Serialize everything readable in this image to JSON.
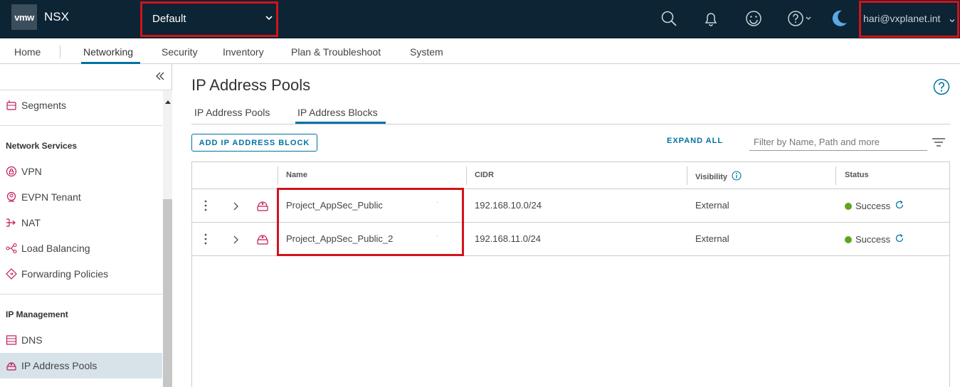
{
  "header": {
    "logo": "vmw",
    "product": "NSX",
    "project": "Default",
    "user": "hari@vxplanet.int",
    "icons": [
      "search-icon",
      "bell-icon",
      "smiley-icon",
      "help-icon",
      "moon-icon"
    ]
  },
  "nav": {
    "items": [
      "Home",
      "Networking",
      "Security",
      "Inventory",
      "Plan & Troubleshoot",
      "System"
    ],
    "active": "Networking"
  },
  "sidebar": {
    "top_item": "Segments",
    "network_services": {
      "heading": "Network Services",
      "items": [
        "VPN",
        "EVPN Tenant",
        "NAT",
        "Load Balancing",
        "Forwarding Policies"
      ]
    },
    "ip_management": {
      "heading": "IP Management",
      "items": [
        "DNS",
        "IP Address Pools"
      ]
    },
    "selected": "IP Address Pools"
  },
  "main": {
    "title": "IP Address Pools",
    "tabs": [
      "IP Address Pools",
      "IP Address Blocks"
    ],
    "active_tab": "IP Address Blocks",
    "add_button": "ADD IP ADDRESS BLOCK",
    "expand_all": "EXPAND ALL",
    "filter_placeholder": "Filter by Name, Path and more"
  },
  "table": {
    "columns": [
      "Name",
      "CIDR",
      "Visibility",
      "Status"
    ],
    "rows": [
      {
        "name": "Project_AppSec_Public",
        "dot": "·",
        "cidr": "192.168.10.0/24",
        "visibility": "External",
        "status": "Success"
      },
      {
        "name": "Project_AppSec_Public_2",
        "dot": "·",
        "cidr": "192.168.11.0/24",
        "visibility": "External",
        "status": "Success"
      }
    ]
  },
  "colors": {
    "header_bg": "#0c2433",
    "accent": "#0072a3",
    "highlight": "#d3131a",
    "success": "#62a420",
    "sidebar_icon": "#c2185b"
  }
}
